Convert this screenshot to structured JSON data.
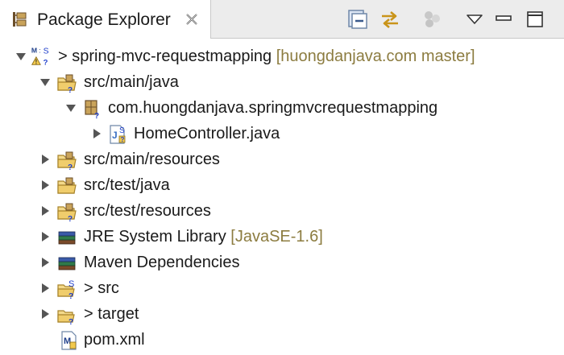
{
  "view": {
    "title": "Package Explorer"
  },
  "toolbar": {
    "icons": [
      "collapse-all-icon",
      "link-with-editor-icon",
      "focus-task-icon",
      "view-menu-icon",
      "minimize-icon",
      "maximize-icon"
    ]
  },
  "tree": {
    "project": {
      "prefix": "> ",
      "name": "spring-mvc-requestmapping",
      "decoration": "[huongdanjava.com master]"
    },
    "src_main_java": {
      "label": "src/main/java"
    },
    "package": {
      "label": "com.huongdanjava.springmvcrequestmapping"
    },
    "home_controller": {
      "label": "HomeController.java"
    },
    "src_main_resources": {
      "label": "src/main/resources"
    },
    "src_test_java": {
      "label": "src/test/java"
    },
    "src_test_resources": {
      "label": "src/test/resources"
    },
    "jre": {
      "label": "JRE System Library",
      "decoration": "[JavaSE-1.6]"
    },
    "maven": {
      "label": "Maven Dependencies"
    },
    "src_folder": {
      "label": "> src"
    },
    "target_folder": {
      "label": "> target"
    },
    "pom": {
      "label": "pom.xml"
    }
  },
  "colors": {
    "decoration": "#8c7c40",
    "folder": "#e8c66a",
    "java_blue": "#3a6fc4"
  }
}
